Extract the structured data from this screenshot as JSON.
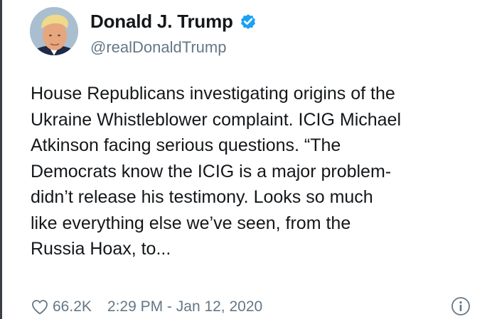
{
  "author": {
    "display_name": "Donald J. Trump",
    "handle": "@realDonaldTrump",
    "verified": true
  },
  "tweet": {
    "lines": [
      "House Republicans investigating origins of the",
      "Ukraine Whistleblower complaint. ICIG Michael",
      "Atkinson facing serious questions. “The",
      "Democrats know the ICIG is a major problem-",
      "didn’t release his testimony. Looks so much",
      "like everything else we’ve seen, from the",
      "Russia Hoax, to..."
    ]
  },
  "footer": {
    "like_count": "66.2K",
    "timestamp": "2:29 PM - Jan 12, 2020"
  },
  "icons": {
    "heart": "heart-icon",
    "verified": "verified-badge-icon",
    "info": "info-icon"
  },
  "colors": {
    "text": "#14171a",
    "secondary": "#657786",
    "verified": "#1da1f2"
  }
}
